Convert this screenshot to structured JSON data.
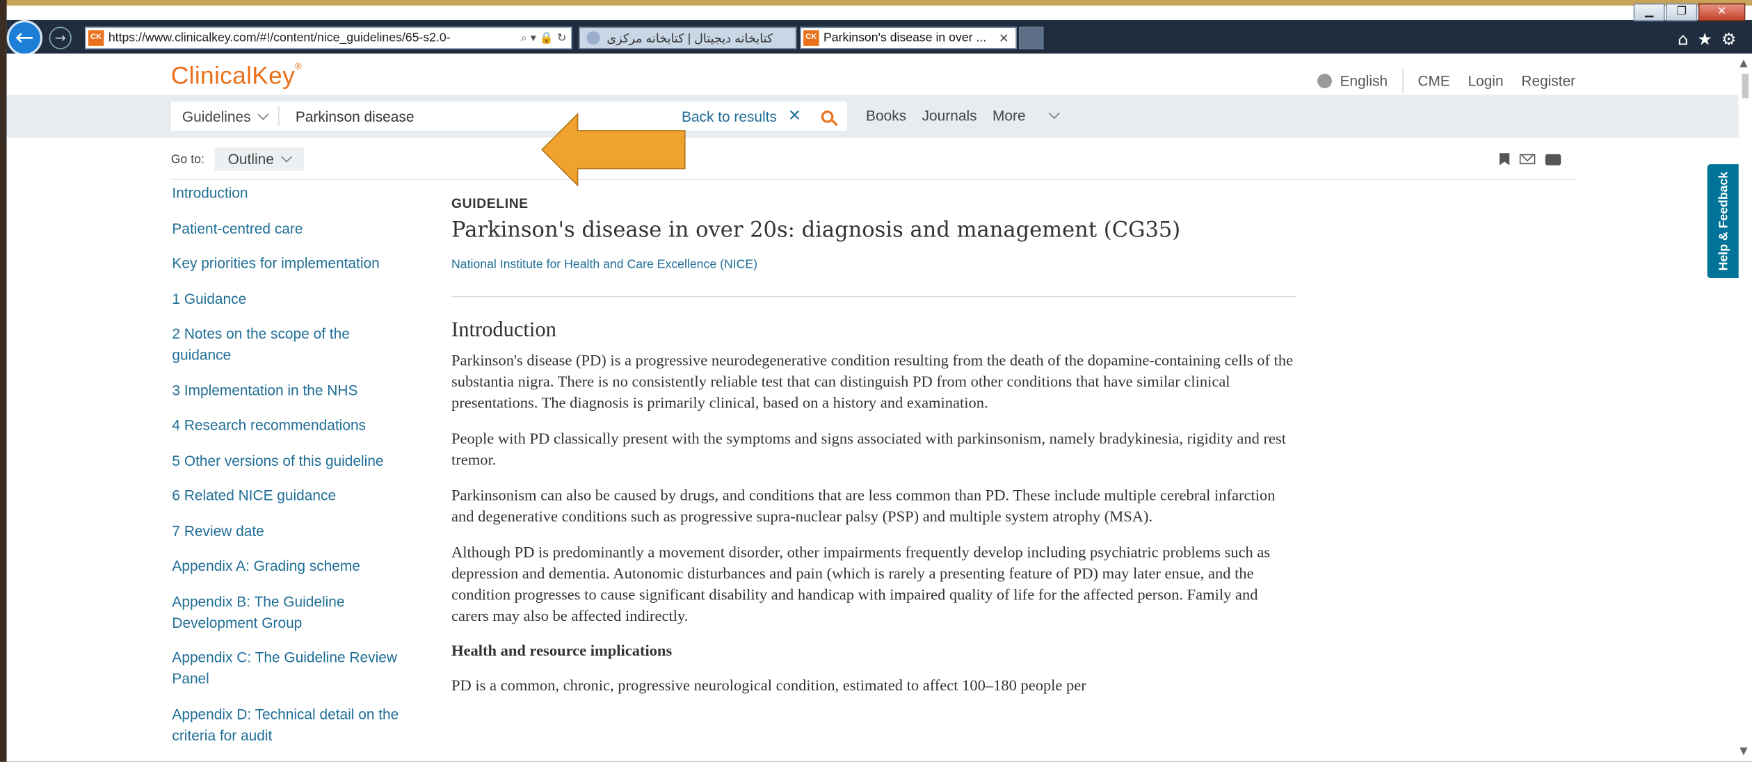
{
  "browser": {
    "url": "https://www.clinicalkey.com/#!/content/nice_guidelines/65-s2.0-",
    "tab1_title": "کتابخانه دیجیتال | کتابخانه مرکزی",
    "tab2_title": "Parkinson's disease in over ...",
    "tab2_icon": "CK"
  },
  "header": {
    "logo": "ClinicalKey",
    "language": "English",
    "links": [
      "CME",
      "Login",
      "Register"
    ]
  },
  "search": {
    "scope": "Guidelines",
    "query": "Parkinson disease",
    "back_label": "Back to results",
    "nav": [
      "Books",
      "Journals",
      "More"
    ]
  },
  "goto": {
    "label": "Go to:",
    "outline_label": "Outline"
  },
  "outline_items": [
    "Introduction",
    "Patient-centred care",
    "Key priorities for implementation",
    "1 Guidance",
    "2 Notes on the scope of the guidance",
    "3 Implementation in the NHS",
    "4 Research recommendations",
    "5 Other versions of this guideline",
    "6 Related NICE guidance",
    "7 Review date",
    "Appendix A: Grading scheme",
    "Appendix B: The Guideline Development Group",
    "Appendix C: The Guideline Review Panel",
    "Appendix D: Technical detail on the criteria for audit"
  ],
  "article": {
    "kicker": "GUIDELINE",
    "title": "Parkinson's disease in over 20s: diagnosis and management (CG35)",
    "author": "National Institute for Health and Care Excellence (NICE)",
    "section_title": "Introduction",
    "paragraphs": [
      "Parkinson's disease (PD) is a progressive neurodegenerative condition resulting from the death of the dopamine-containing cells of the substantia nigra. There is no consistently reliable test that can distinguish PD from other conditions that have similar clinical presentations. The diagnosis is primarily clinical, based on a history and examination.",
      "People with PD classically present with the symptoms and signs associated with parkinsonism, namely bradykinesia, rigidity and rest tremor.",
      "Parkinsonism can also be caused by drugs, and conditions that are less common than PD. These include multiple cerebral infarction and degenerative conditions such as progressive supra-nuclear palsy (PSP) and multiple system atrophy (MSA).",
      "Although PD is predominantly a movement disorder, other impairments frequently develop including psychiatric problems such as depression and dementia. Autonomic disturbances and pain (which is rarely a presenting feature of PD) may later ensue, and the condition progresses to cause significant disability and handicap with impaired quality of life for the affected person. Family and carers may also be affected indirectly."
    ],
    "subheading": "Health and resource implications",
    "after_paragraph": "PD is a common, chronic, progressive neurological condition, estimated to affect 100–180 people per"
  },
  "feedback": "Help & Feedback",
  "colors": {
    "brand_orange": "#e9711c",
    "link_blue": "#1f6e96",
    "annotation_arrow": "#f0a22e",
    "feedback_teal": "#007398"
  }
}
